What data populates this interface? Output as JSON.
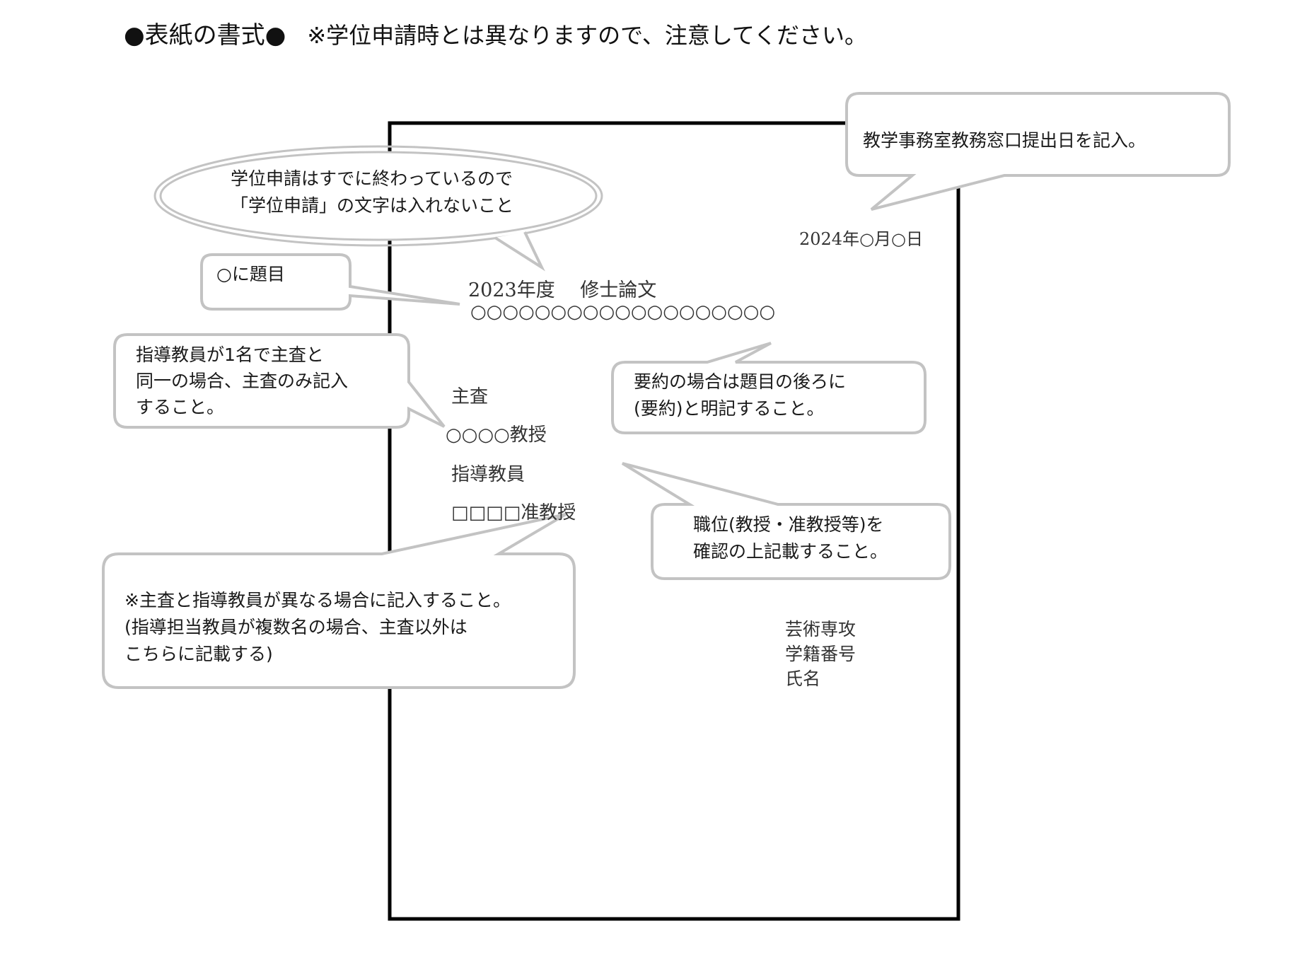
{
  "heading": {
    "title": "●表紙の書式●",
    "note": "※学位申請時とは異なりますので、注意してください。"
  },
  "cover": {
    "date": "2024年○月○日",
    "year_thesis": "2023年度　 修士論文",
    "title_placeholder": "○○○○○○○○○○○○○○○○○○○",
    "chief_label": "主査",
    "chief_name": "○○○○教授",
    "advisor_label": "指導教員",
    "advisor_name": "□□□□准教授",
    "major": "芸術専攻",
    "student_id": "学籍番号",
    "name": "氏名"
  },
  "callouts": {
    "submission_date": [
      "教学事務室教務窓口提出日を記入。"
    ],
    "no_degree_application": [
      "学位申請はすでに終わっているので",
      "「学位申請」の文字は入れないこと"
    ],
    "title_hint": [
      "○に題目"
    ],
    "single_advisor": [
      "指導教員が1名で主査と",
      "同一の場合、主査のみ記入",
      "すること。"
    ],
    "summary": [
      "要約の場合は題目の後ろに",
      "(要約)と明記すること。"
    ],
    "position": [
      "職位(教授・准教授等)を",
      "確認の上記載すること。"
    ],
    "different_advisor": [
      "※主査と指導教員が異なる場合に記入すること。",
      "(指導担当教員が複数名の場合、主査以外は",
      "こちらに記載する)"
    ]
  }
}
